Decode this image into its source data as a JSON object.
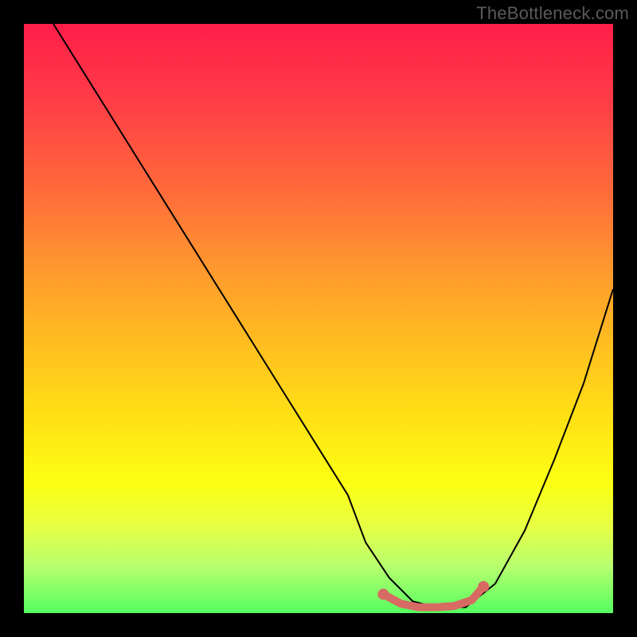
{
  "watermark": "TheBottleneck.com",
  "chart_data": {
    "type": "line",
    "title": "",
    "xlabel": "",
    "ylabel": "",
    "xlim": [
      0,
      100
    ],
    "ylim": [
      0,
      100
    ],
    "series": [
      {
        "name": "bottleneck-curve",
        "x": [
          5,
          10,
          15,
          20,
          25,
          30,
          35,
          40,
          45,
          50,
          55,
          58,
          62,
          66,
          70,
          75,
          80,
          85,
          90,
          95,
          100
        ],
        "y": [
          100,
          92,
          84,
          76,
          68,
          60,
          52,
          44,
          36,
          28,
          20,
          12,
          6,
          2,
          1,
          1,
          5,
          14,
          26,
          39,
          55
        ],
        "color": "#000000",
        "stroke_width": 2
      },
      {
        "name": "highlight-segment",
        "x": [
          61,
          64,
          67,
          70,
          73,
          76,
          78
        ],
        "y": [
          3.2,
          1.6,
          1.0,
          1.0,
          1.2,
          2.2,
          4.5
        ],
        "color": "#d76a63",
        "stroke_width": 10,
        "endpoint_marker": true
      }
    ],
    "background_gradient_top": "#ff1e49",
    "background_gradient_bottom": "#55ff60"
  }
}
